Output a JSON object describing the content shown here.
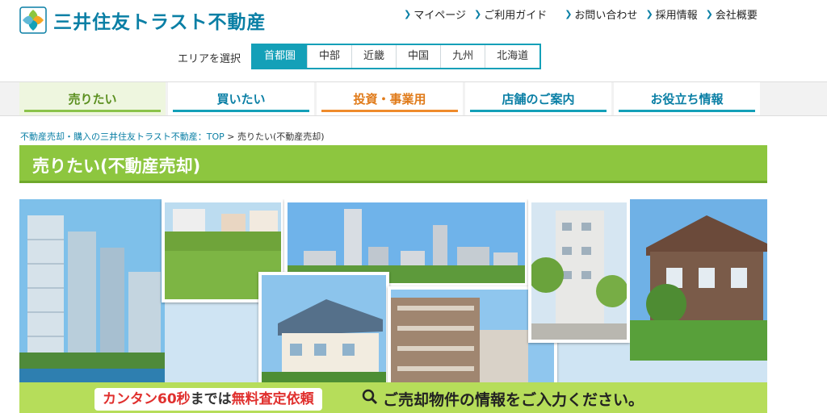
{
  "brand": {
    "name": "三井住友トラスト不動産",
    "color": "#0a7fa5"
  },
  "util_nav": {
    "my_page": "マイページ",
    "guide": "ご利用ガイド",
    "contact": "お問い合わせ",
    "recruit": "採用情報",
    "company": "会社概要"
  },
  "area": {
    "label": "エリアを選択",
    "options": [
      "首都圏",
      "中部",
      "近畿",
      "中国",
      "九州",
      "北海道"
    ],
    "selected": "首都圏"
  },
  "global_nav": {
    "items": [
      "売りたい",
      "買いたい",
      "投資・事業用",
      "店舗のご案内",
      "お役立ち情報"
    ],
    "active": "売りたい"
  },
  "breadcrumb": {
    "home": "不動産売却・購入の三井住友トラスト不動産：TOP",
    "separator": ">",
    "current": "売りたい(不動産売却)"
  },
  "page": {
    "title": "売りたい(不動産売却)"
  },
  "cta": {
    "pill_part1": "カンタン60秒",
    "pill_part2": "までは",
    "pill_part3": "無料査定依頼",
    "message": "ご売却物件の情報をご入力ください。"
  },
  "colors": {
    "accent_green": "#8dc63f",
    "accent_teal": "#14a0b8",
    "accent_orange": "#ef8b2c",
    "cta_red": "#e0302e"
  },
  "icons": [
    "logo-mark",
    "chevron-right-icon",
    "search-icon"
  ]
}
